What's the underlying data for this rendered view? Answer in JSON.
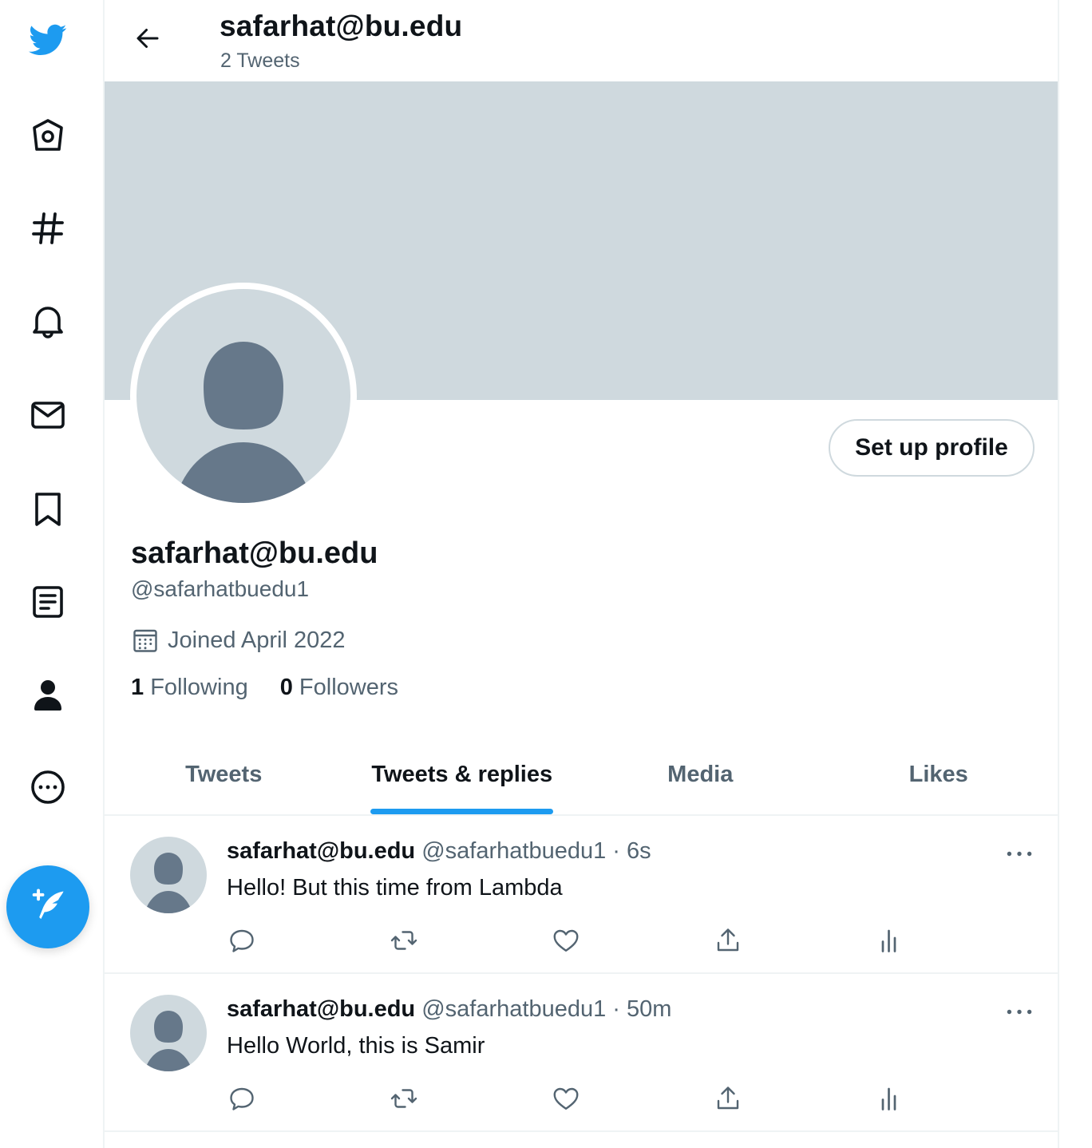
{
  "colors": {
    "accent": "#1d9bf0",
    "banner": "#cfd9de",
    "muted": "#536471",
    "avatar_fg": "#66788a"
  },
  "nav": {
    "items": [
      {
        "icon": "twitter-logo-icon"
      },
      {
        "icon": "home-icon"
      },
      {
        "icon": "explore-hashtag-icon"
      },
      {
        "icon": "notifications-bell-icon"
      },
      {
        "icon": "messages-envelope-icon"
      },
      {
        "icon": "bookmarks-icon"
      },
      {
        "icon": "lists-icon"
      },
      {
        "icon": "profile-icon"
      },
      {
        "icon": "more-icon"
      }
    ],
    "compose_icon": "compose-tweet-icon"
  },
  "header": {
    "title": "safarhat@bu.edu",
    "subtitle": "2 Tweets"
  },
  "profile": {
    "setup_button": "Set up profile",
    "name": "safarhat@bu.edu",
    "handle": "@safarhatbuedu1",
    "joined": "Joined April 2022",
    "following_count": "1",
    "following_label": "Following",
    "followers_count": "0",
    "followers_label": "Followers"
  },
  "tabs": [
    {
      "label": "Tweets",
      "active": false
    },
    {
      "label": "Tweets & replies",
      "active": true
    },
    {
      "label": "Media",
      "active": false
    },
    {
      "label": "Likes",
      "active": false
    }
  ],
  "tweets": [
    {
      "name": "safarhat@bu.edu",
      "handle": "@safarhatbuedu1",
      "sep": "·",
      "time": "6s",
      "text": "Hello! But this time from Lambda"
    },
    {
      "name": "safarhat@bu.edu",
      "handle": "@safarhatbuedu1",
      "sep": "·",
      "time": "50m",
      "text": "Hello World, this is Samir"
    }
  ]
}
